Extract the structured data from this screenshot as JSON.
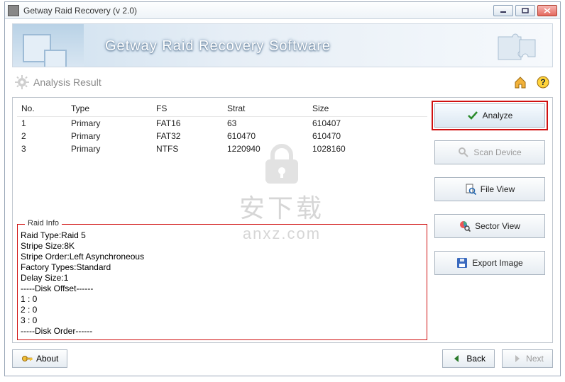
{
  "window": {
    "title": "Getway Raid Recovery (v 2.0)"
  },
  "banner": {
    "title": "Getway Raid Recovery Software"
  },
  "section": {
    "title": "Analysis Result"
  },
  "table": {
    "headers": {
      "no": "No.",
      "type": "Type",
      "fs": "FS",
      "strat": "Strat",
      "size": "Size"
    },
    "rows": [
      {
        "no": "1",
        "type": "Primary",
        "fs": "FAT16",
        "strat": "63",
        "size": "610407"
      },
      {
        "no": "2",
        "type": "Primary",
        "fs": "FAT32",
        "strat": "610470",
        "size": "610470"
      },
      {
        "no": "3",
        "type": "Primary",
        "fs": "NTFS",
        "strat": "1220940",
        "size": "1028160"
      }
    ]
  },
  "raid_info": {
    "title": "Raid Info",
    "lines": [
      "Raid Type:Raid 5",
      "Stripe Size:8K",
      "Stripe Order:Left Asynchroneous",
      "Factory Types:Standard",
      "Delay Size:1",
      "-----Disk Offset------",
      "1 : 0",
      "2 : 0",
      "3 : 0",
      "-----Disk Order------"
    ]
  },
  "sidebar": {
    "analyze": "Analyze",
    "scan_device": "Scan Device",
    "file_view": "File View",
    "sector_view": "Sector View",
    "export_image": "Export Image"
  },
  "bottom": {
    "about": "About",
    "back": "Back",
    "next": "Next"
  },
  "watermark": {
    "cn": "安下载",
    "en": "anxz.com"
  }
}
